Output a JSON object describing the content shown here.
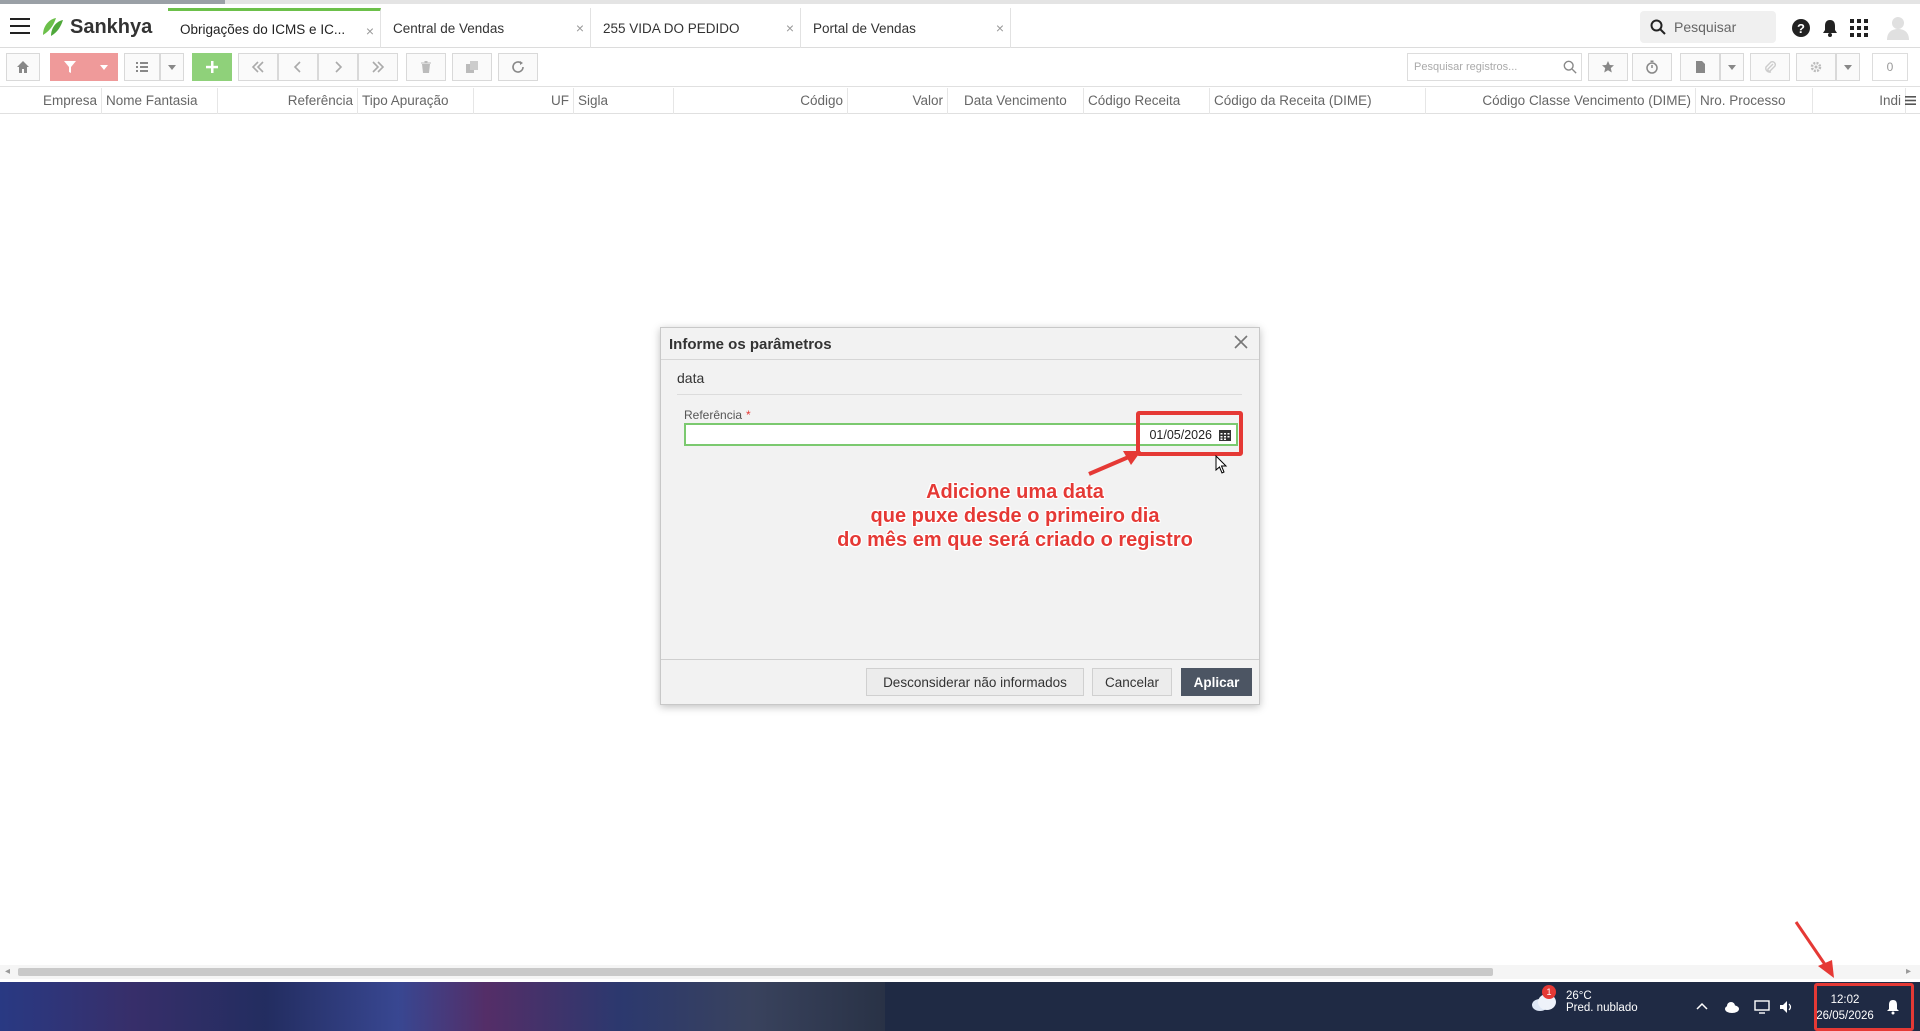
{
  "app": {
    "brand": "Sankhya",
    "brand_color": "#6cc04a"
  },
  "tabs": [
    {
      "label": "Obrigações do ICMS e IC..."
    },
    {
      "label": "Central de Vendas"
    },
    {
      "label": "255 VIDA DO PEDIDO"
    },
    {
      "label": "Portal de Vendas"
    }
  ],
  "header": {
    "search_placeholder": "Pesquisar"
  },
  "toolbar": {
    "search_placeholder": "Pesquisar registros...",
    "record_count": "0"
  },
  "columns": [
    "Empresa",
    "Nome Fantasia",
    "Referência",
    "Tipo Apuração",
    "UF",
    "Sigla",
    "Código",
    "Valor",
    "Data Vencimento",
    "Código Receita",
    "Código da Receita (DIME)",
    "Código Classe Vencimento (DIME)",
    "Nro. Processo",
    "Indi"
  ],
  "dialog": {
    "title": "Informe os parâmetros",
    "section": "data",
    "field_label": "Referência",
    "required_mark": "*",
    "field_value": "01/05/2026",
    "buttons": {
      "ignore": "Desconsiderar não informados",
      "cancel": "Cancelar",
      "apply": "Aplicar"
    }
  },
  "annotation": {
    "lines": [
      "Adicione uma data",
      "que puxe desde o primeiro dia",
      "do mês em que será criado o registro"
    ],
    "color": "#e53935"
  },
  "taskbar": {
    "weather_temp": "26°C",
    "weather_desc": "Pred. nublado",
    "weather_badge": "1",
    "time": "12:02",
    "date": "26/05/2026"
  }
}
